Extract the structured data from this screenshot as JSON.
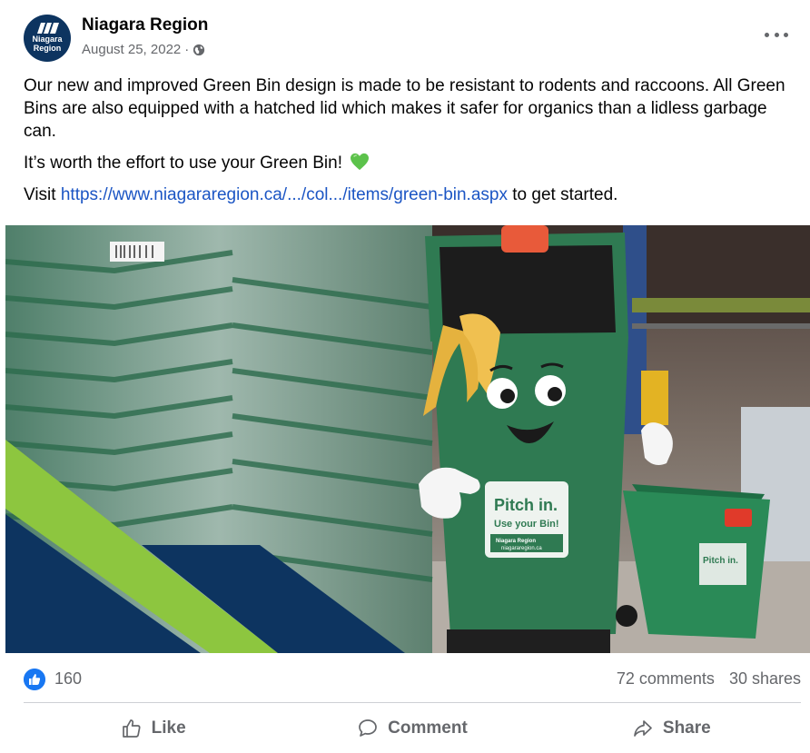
{
  "header": {
    "page_name": "Niagara Region",
    "avatar_line1": "Niagara",
    "avatar_line2": "Region",
    "date": "August 25, 2022",
    "separator": "·",
    "audience_icon": "globe-icon",
    "more_icon": "more-options-icon"
  },
  "post": {
    "paragraph1": "Our new and improved Green Bin design is made to be resistant to rodents and raccoons. All Green Bins are also equipped with a hatched lid which makes it safer for organics than a lidless garbage can.",
    "paragraph2": "It’s worth the effort to use your Green Bin!",
    "emoji_icon": "green-heart-icon",
    "paragraph3_prefix": "Visit ",
    "link_text": "https://www.niagararegion.ca/.../col.../items/green-bin.aspx",
    "paragraph3_suffix": " to get started."
  },
  "photo": {
    "mascot_sign_line1": "Pitch in.",
    "mascot_sign_line2": "Use your Bin!",
    "mascot_sign_brand": "Niagara Region",
    "mascot_sign_url": "niagararegion.ca",
    "bin_sign": "Pitch in."
  },
  "stats": {
    "like_icon": "like-reaction-icon",
    "like_count": "160",
    "comments": "72 comments",
    "shares": "30 shares"
  },
  "actions": {
    "like_label": "Like",
    "comment_label": "Comment",
    "share_label": "Share"
  },
  "colors": {
    "link": "#1b55c4",
    "accent_blue": "#1877f2",
    "secondary_text": "#65676b",
    "brand_navy": "#0d3460",
    "brand_green": "#8dc63f",
    "bin_green": "#2f7a52"
  }
}
